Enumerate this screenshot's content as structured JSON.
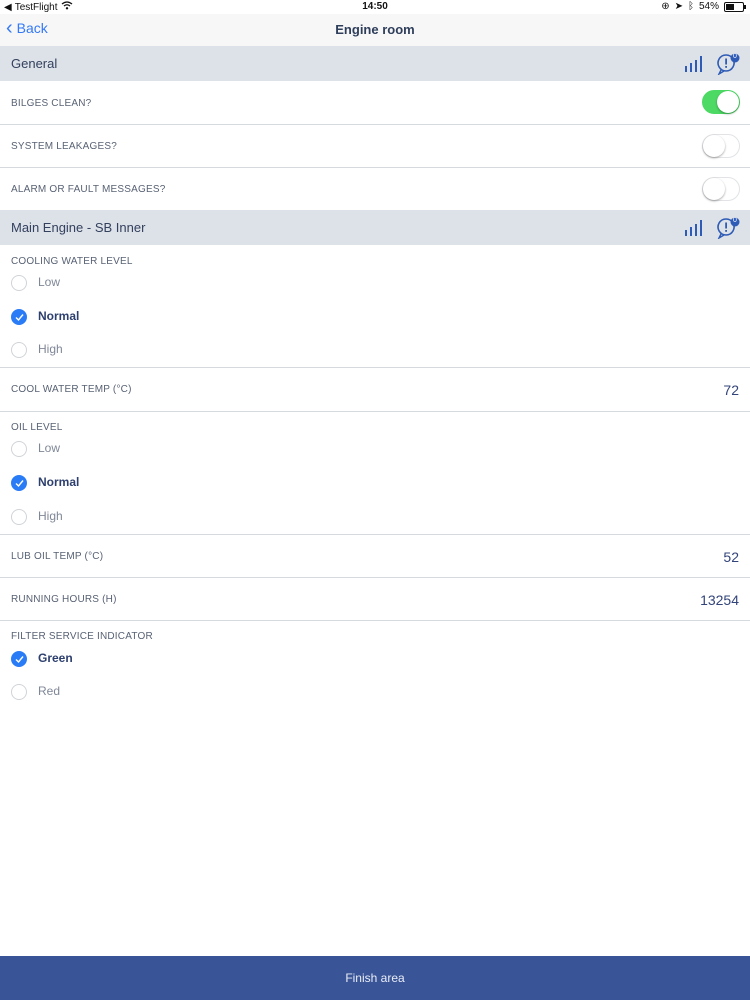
{
  "status_bar": {
    "carrier": "TestFlight",
    "time": "14:50",
    "battery": "54%",
    "battery_level": 0.54
  },
  "nav": {
    "back_label": "Back",
    "title": "Engine room"
  },
  "sections": {
    "general": {
      "title": "General",
      "badge": "0"
    },
    "engine": {
      "title": "Main Engine - SB Inner",
      "badge": "0"
    }
  },
  "general_rows": [
    {
      "label": "BILGES CLEAN?",
      "on": true
    },
    {
      "label": "SYSTEM LEAKAGES?",
      "on": false
    },
    {
      "label": "ALARM OR FAULT MESSAGES?",
      "on": false
    }
  ],
  "cooling_water_level": {
    "label": "COOLING WATER LEVEL",
    "options": [
      "Low",
      "Normal",
      "High"
    ],
    "selected": "Normal"
  },
  "cool_water_temp": {
    "label": "COOL WATER TEMP (°C)",
    "value": "72"
  },
  "oil_level": {
    "label": "OIL LEVEL",
    "options": [
      "Low",
      "Normal",
      "High"
    ],
    "selected": "Normal"
  },
  "lub_oil_temp": {
    "label": "LUB OIL TEMP (°C)",
    "value": "52"
  },
  "running_hours": {
    "label": "RUNNING HOURS (H)",
    "value": "13254"
  },
  "filter_service": {
    "label": "FILTER SERVICE INDICATOR",
    "options": [
      "Green",
      "Red"
    ],
    "selected": "Green"
  },
  "footer": {
    "finish_label": "Finish area"
  },
  "colors": {
    "accent": "#3479f6",
    "toggle_on": "#4cd964",
    "footer_bg": "#3a5597",
    "section_bg": "#dde1e8"
  }
}
